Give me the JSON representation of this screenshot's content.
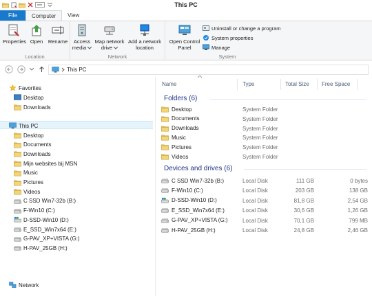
{
  "window": {
    "title": "This PC"
  },
  "tabs": [
    {
      "label": "File"
    },
    {
      "label": "Computer"
    },
    {
      "label": "View"
    }
  ],
  "ribbon": {
    "location_group": {
      "label": "Location",
      "properties": "Properties",
      "open": "Open",
      "rename": "Rename"
    },
    "network_group": {
      "label": "Network",
      "access_media": "Access media",
      "map_network_drive": "Map network drive",
      "add_network_location": "Add a network location"
    },
    "system_group": {
      "label": "System",
      "open_control_panel": "Open Control Panel",
      "uninstall": "Uninstall or change a program",
      "system_properties": "System properties",
      "manage": "Manage"
    }
  },
  "address": {
    "path": "This PC"
  },
  "nav": {
    "favorites": {
      "label": "Favorites",
      "items": [
        "Desktop",
        "Downloads"
      ]
    },
    "this_pc": {
      "label": "This PC",
      "items": [
        {
          "label": "Desktop",
          "icon": "folder-icon"
        },
        {
          "label": "Documents",
          "icon": "folder-icon"
        },
        {
          "label": "Downloads",
          "icon": "folder-icon"
        },
        {
          "label": "Mijn websites bij MSN",
          "icon": "folder-icon"
        },
        {
          "label": "Music",
          "icon": "folder-icon"
        },
        {
          "label": "Pictures",
          "icon": "folder-icon"
        },
        {
          "label": "Videos",
          "icon": "folder-icon"
        },
        {
          "label": "C SSD Win7-32b (B:)",
          "icon": "drive-icon"
        },
        {
          "label": "F-Win10 (C:)",
          "icon": "drive-icon"
        },
        {
          "label": "D-SSD-Win10 (D:)",
          "icon": "windows-drive-icon"
        },
        {
          "label": "E_SSD_Win7x64 (E:)",
          "icon": "drive-icon"
        },
        {
          "label": "G-PAV_XP+VISTA (G:)",
          "icon": "drive-icon"
        },
        {
          "label": "H-PAV_25GB (H:)",
          "icon": "drive-icon"
        }
      ]
    },
    "network": {
      "label": "Network"
    }
  },
  "columns": {
    "name": "Name",
    "type": "Type",
    "total_size": "Total Size",
    "free_space": "Free Space"
  },
  "folders_group": {
    "label": "Folders (6)",
    "items": [
      {
        "name": "Desktop",
        "type": "System Folder"
      },
      {
        "name": "Documents",
        "type": "System Folder"
      },
      {
        "name": "Downloads",
        "type": "System Folder"
      },
      {
        "name": "Music",
        "type": "System Folder"
      },
      {
        "name": "Pictures",
        "type": "System Folder"
      },
      {
        "name": "Videos",
        "type": "System Folder"
      }
    ]
  },
  "drives_group": {
    "label": "Devices and drives (6)",
    "items": [
      {
        "name": "C SSD Win7-32b (B:)",
        "type": "Local Disk",
        "total": "111 GB",
        "free": "0 bytes"
      },
      {
        "name": "F-Win10 (C:)",
        "type": "Local Disk",
        "total": "203 GB",
        "free": "138 GB"
      },
      {
        "name": "D-SSD-Win10 (D:)",
        "type": "Local Disk",
        "total": "81,8 GB",
        "free": "2,54 GB"
      },
      {
        "name": "E_SSD_Win7x64 (E:)",
        "type": "Local Disk",
        "total": "30,6 GB",
        "free": "1,26 GB"
      },
      {
        "name": "G-PAV_XP+VISTA (G:)",
        "type": "Local Disk",
        "total": "70,1 GB",
        "free": "799 MB"
      },
      {
        "name": "H-PAV_25GB (H:)",
        "type": "Local Disk",
        "total": "24,8 GB",
        "free": "2,46 GB"
      }
    ]
  },
  "colors": {
    "file_tab": "#1979ca",
    "group_header": "#1e3287",
    "folder": "#e8c25a",
    "selection": "#e5f3fb"
  }
}
